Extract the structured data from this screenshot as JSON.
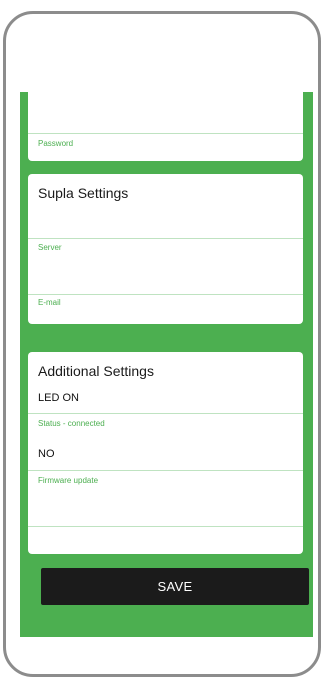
{
  "credentials": {
    "password_label": "Password"
  },
  "supla_settings": {
    "title": "Supla Settings",
    "server_label": "Server",
    "email_label": "E-mail"
  },
  "additional_settings": {
    "title": "Additional Settings",
    "led_value": "LED ON",
    "status_label": "Status - connected",
    "firmware_value": "NO",
    "firmware_label": "Firmware update"
  },
  "actions": {
    "save_label": "SAVE"
  },
  "colors": {
    "accent": "#4caf50",
    "button": "#1b1b1b",
    "frame": "#8c8c8c"
  }
}
